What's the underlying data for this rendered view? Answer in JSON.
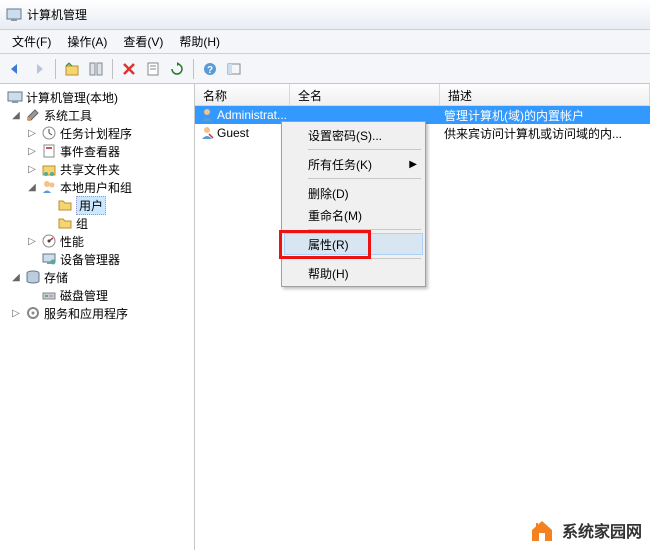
{
  "window": {
    "title": "计算机管理"
  },
  "menubar": {
    "file": "文件(F)",
    "action": "操作(A)",
    "view": "查看(V)",
    "help": "帮助(H)"
  },
  "tree": {
    "root": "计算机管理(本地)",
    "systools": "系统工具",
    "scheduler": "任务计划程序",
    "eventviewer": "事件查看器",
    "shared": "共享文件夹",
    "localusers": "本地用户和组",
    "users": "用户",
    "groups": "组",
    "perf": "性能",
    "devmgr": "设备管理器",
    "storage": "存储",
    "diskmgmt": "磁盘管理",
    "services": "服务和应用程序"
  },
  "list": {
    "headers": {
      "name": "名称",
      "fullname": "全名",
      "desc": "描述"
    },
    "rows": [
      {
        "name": "Administrat...",
        "fullname": "",
        "desc": "管理计算机(域)的内置帐户"
      },
      {
        "name": "Guest",
        "fullname": "",
        "desc": "供来宾访问计算机或访问域的内..."
      }
    ]
  },
  "context": {
    "setpwd": "设置密码(S)...",
    "alltasks": "所有任务(K)",
    "delete": "删除(D)",
    "rename": "重命名(M)",
    "properties": "属性(R)",
    "help": "帮助(H)"
  },
  "watermark": "系统家园网"
}
